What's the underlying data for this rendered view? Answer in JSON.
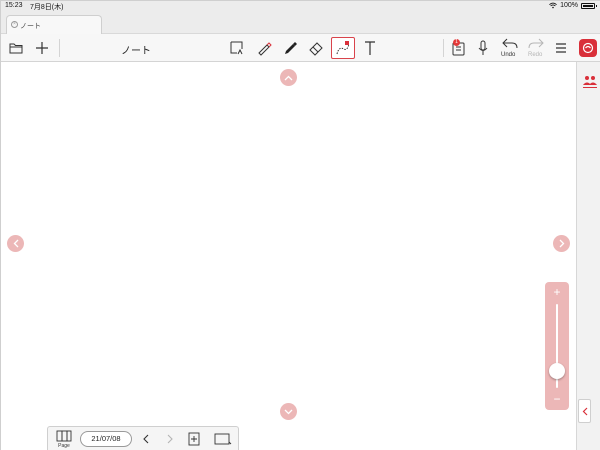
{
  "status_bar": {
    "time": "15:23",
    "date": "7月8日(木)",
    "battery": "100%",
    "wifi_icon": "wifi-icon",
    "battery_icon": "battery-icon"
  },
  "tabs": [
    {
      "label": "ノート",
      "close_icon": "close-circle-icon"
    }
  ],
  "toolbar": {
    "title": "ノート",
    "undo_label": "Undo",
    "redo_label": "Redo",
    "notification_badge": "1",
    "icons": [
      "folder-icon",
      "plus-icon",
      "lasso-select-icon",
      "pen-icon",
      "marker-icon",
      "eraser-icon",
      "shape-icon",
      "text-icon",
      "notebook-icon",
      "microphone-icon",
      "undo-icon",
      "redo-icon",
      "menu-icon",
      "app-logo-icon"
    ]
  },
  "side_panel": {
    "icons": [
      "people-icon",
      "chevron-left-icon"
    ]
  },
  "zoom": {
    "plus": "+",
    "minus": "−",
    "level": 0.2
  },
  "page_bar": {
    "page_label": "Page",
    "date": "21/07/08"
  },
  "colors": {
    "accent": "#d9303a",
    "scroll_button": "#ecb7b7",
    "toolbar_bg": "#f7f7f7"
  }
}
